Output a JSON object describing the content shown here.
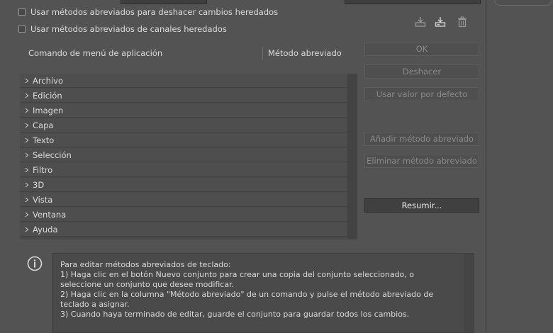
{
  "checkboxes": {
    "undo_label": "Usar métodos abreviados para deshacer cambios heredados",
    "channels_label": "Usar métodos abreviados de canales heredados"
  },
  "table": {
    "col_command": "Comando de menú de aplicación",
    "col_shortcut": "Método abreviado",
    "rows": [
      {
        "label": "Archivo"
      },
      {
        "label": "Edición"
      },
      {
        "label": "Imagen"
      },
      {
        "label": "Capa"
      },
      {
        "label": "Texto"
      },
      {
        "label": "Selección"
      },
      {
        "label": "Filtro"
      },
      {
        "label": "3D"
      },
      {
        "label": "Vista"
      },
      {
        "label": "Ventana"
      },
      {
        "label": "Ayuda"
      }
    ]
  },
  "buttons": {
    "ok": "OK",
    "undo": "Deshacer",
    "default": "Usar valor por defecto",
    "add_shortcut": "Añadir método abreviado",
    "delete_shortcut": "Eliminar método abreviado",
    "summarize": "Resumir..."
  },
  "info": {
    "text": "Para editar métodos abreviados de teclado:\n1) Haga clic en el botón Nuevo conjunto para crear una copia del conjunto seleccionado, o seleccione un conjunto que desee modificar.\n2) Haga clic en la columna \"Método abreviado\" de un comando y pulse el método abreviado de teclado a asignar.\n3) Cuando haya terminado de editar, guarde el conjunto para guardar todos los cambios."
  },
  "icons": {
    "save": "save-set-icon",
    "new": "new-set-icon",
    "delete": "trash-icon",
    "chevron": "chevron-right-icon",
    "info": "info-icon"
  },
  "colors": {
    "background": "#535353",
    "row": "#4e4e4e",
    "active_button": "#404040"
  }
}
